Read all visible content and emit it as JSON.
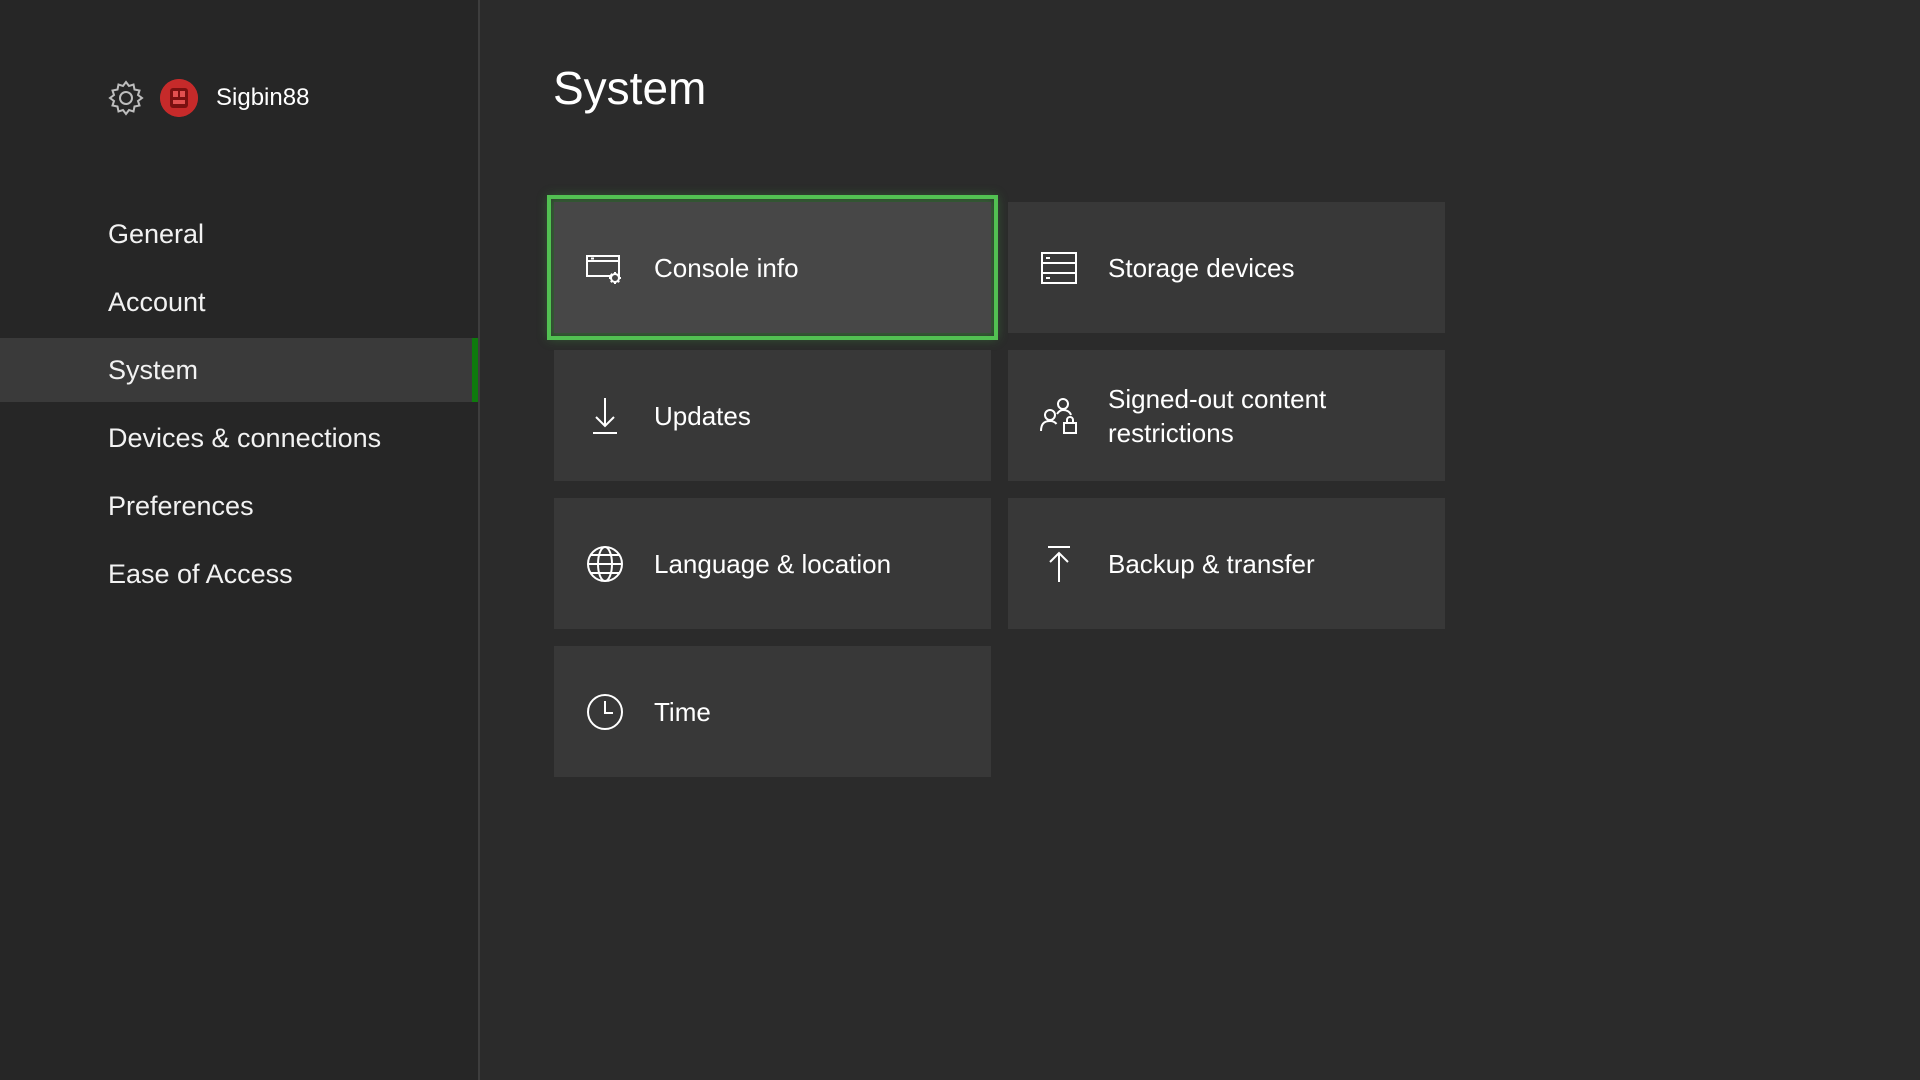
{
  "profile": {
    "gamertag": "Sigbin88",
    "avatar_color": "#d12f2f"
  },
  "sidebar": {
    "items": [
      {
        "label": "General"
      },
      {
        "label": "Account"
      },
      {
        "label": "System",
        "selected": true
      },
      {
        "label": "Devices & connections"
      },
      {
        "label": "Preferences"
      },
      {
        "label": "Ease of Access"
      }
    ]
  },
  "main": {
    "title": "System",
    "tiles": [
      {
        "label": "Console info",
        "icon": "console-info-icon",
        "focused": true
      },
      {
        "label": "Storage devices",
        "icon": "storage-devices-icon"
      },
      {
        "label": "Updates",
        "icon": "download-arrow-icon"
      },
      {
        "label": "Signed-out content restrictions",
        "icon": "person-lock-icon"
      },
      {
        "label": "Language & location",
        "icon": "globe-icon"
      },
      {
        "label": "Backup & transfer",
        "icon": "upload-arrow-icon"
      },
      {
        "label": "Time",
        "icon": "clock-icon"
      }
    ]
  },
  "colors": {
    "background": "#2b2b2b",
    "sidebar": "#262626",
    "tile": "#383838",
    "focus_outline": "#52c152",
    "selection_bar": "#0e7a0d"
  }
}
